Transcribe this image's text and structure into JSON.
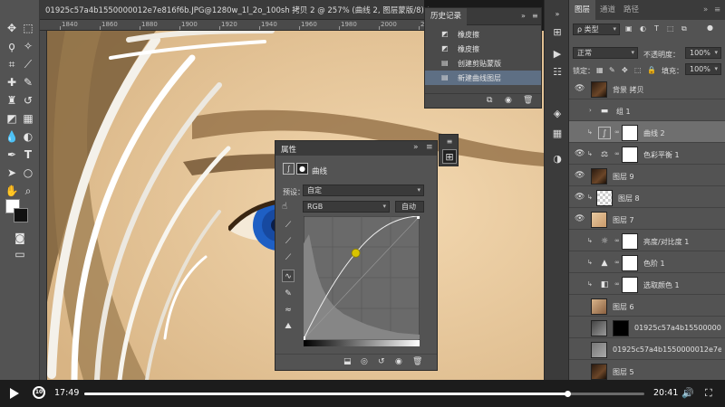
{
  "document": {
    "tab_label": "01925c57a4b1550000012e7e816f6b.JPG@1280w_1l_2o_100sh 拷贝 2 @ 257% (曲线 2, 图层蒙版/8) *",
    "close_glyph": "×"
  },
  "ruler": {
    "ticks": [
      "1840",
      "1860",
      "1880",
      "1900",
      "1920",
      "1940",
      "1960",
      "1980",
      "2000",
      "2020"
    ]
  },
  "history": {
    "tab_label": "历史记录",
    "menu_glyph": "≡",
    "collapse_glyph": "»",
    "items": [
      {
        "label": "橡皮擦",
        "icon": "eraser-icon",
        "active": false
      },
      {
        "label": "橡皮擦",
        "icon": "eraser-icon",
        "active": false
      },
      {
        "label": "创建剪贴蒙版",
        "icon": "document-icon",
        "active": false
      },
      {
        "label": "新建曲线图层",
        "icon": "document-icon",
        "active": true
      }
    ]
  },
  "properties": {
    "tab_label": "属性",
    "collapse_glyph": "»",
    "menu_glyph": "≡",
    "adjustment_name": "曲线",
    "preset_label": "预设：",
    "preset_value": "自定",
    "channel_value": "RGB",
    "auto_button": "自动",
    "curve_point": {
      "input": 0.45,
      "output": 0.7
    }
  },
  "layers": {
    "tabs": [
      "图层",
      "通道",
      "路径"
    ],
    "filter_label": "ρ 类型",
    "blend_mode": "正常",
    "opacity_label": "不透明度：",
    "opacity_value": "100%",
    "lock_label": "锁定：",
    "fill_label": "填充：",
    "fill_value": "100%",
    "items": [
      {
        "name": "背景 拷贝",
        "kind": "photo",
        "eye": true,
        "active": false
      },
      {
        "name": "组 1",
        "kind": "group",
        "eye": false,
        "active": false
      },
      {
        "name": "曲线 2",
        "kind": "curves",
        "eye": false,
        "active": true,
        "icon": "curves-icon"
      },
      {
        "name": "色彩平衡 1",
        "kind": "adjust",
        "eye": true,
        "active": false,
        "icon": "balance-icon"
      },
      {
        "name": "图层 9",
        "kind": "photo",
        "eye": true,
        "active": false
      },
      {
        "name": "图层 8",
        "kind": "transparent",
        "eye": true,
        "active": false
      },
      {
        "name": "图层 7",
        "kind": "skin",
        "eye": true,
        "active": false
      },
      {
        "name": "亮度/对比度 1",
        "kind": "adjust",
        "eye": false,
        "active": false,
        "icon": "brightness-icon"
      },
      {
        "name": "色阶 1",
        "kind": "adjust",
        "eye": false,
        "active": false,
        "icon": "levels-icon"
      },
      {
        "name": "选取颜色 1",
        "kind": "adjust",
        "eye": false,
        "active": false,
        "icon": "selective-color-icon"
      },
      {
        "name": "图层 6",
        "kind": "skin2",
        "eye": false,
        "active": false
      },
      {
        "name": "01925c57a4b1550000001...",
        "kind": "photo-mask",
        "eye": false,
        "active": false
      },
      {
        "name": "01925c57a4b1550000012e7e816f6...",
        "kind": "gray",
        "eye": false,
        "active": false
      },
      {
        "name": "图层 5",
        "kind": "photo",
        "eye": false,
        "active": false
      }
    ]
  },
  "video": {
    "current_time": "17:49",
    "total_time": "20:41",
    "progress": 0.862,
    "replay_label": "10"
  }
}
